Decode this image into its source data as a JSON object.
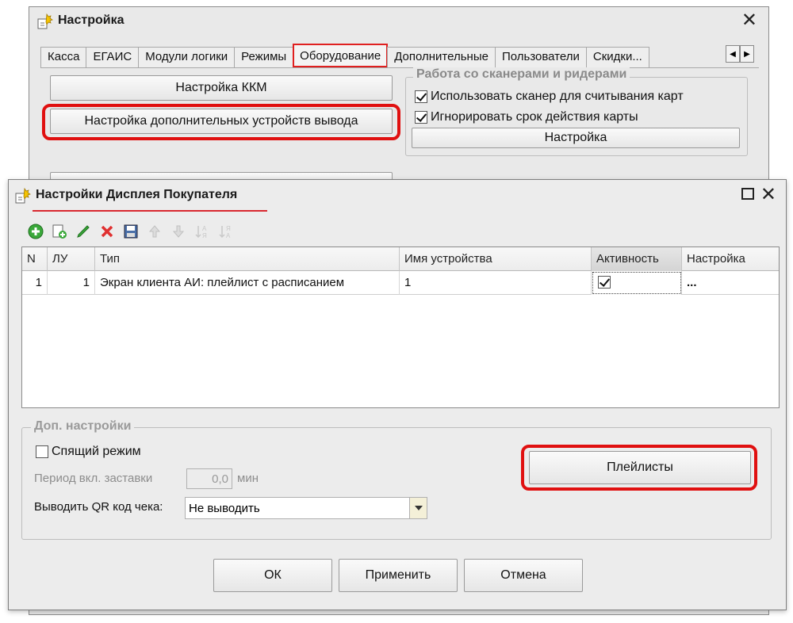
{
  "bg_window": {
    "title": "Настройка",
    "tabs": [
      "Касса",
      "ЕГАИС",
      "Модули логики",
      "Режимы",
      "Оборудование",
      "Дополнительные",
      "Пользователи",
      "Скидки..."
    ],
    "active_tab": "Оборудование",
    "kkm_button": "Настройка ККМ",
    "extra_devices_button": "Настройка дополнительных устройств вывода",
    "scanner_group": {
      "title": "Работа со сканерами и ридерами",
      "use_scanner": "Использовать сканер для считывания карт",
      "use_scanner_checked": true,
      "ignore_expiry": "Игнорировать срок действия карты",
      "ignore_expiry_checked": true,
      "settings_button": "Настройка"
    }
  },
  "dialog": {
    "title": "Настройки Дисплея Покупателя",
    "toolbar_icons": [
      "add-icon",
      "copy-icon",
      "edit-icon",
      "delete-icon",
      "save-icon",
      "move-up-icon",
      "move-down-icon",
      "sort-asc-icon",
      "sort-desc-icon"
    ],
    "table": {
      "columns": [
        "N",
        "ЛУ",
        "Тип",
        "Имя устройства",
        "Активность",
        "Настройка"
      ],
      "rows": [
        {
          "n": "1",
          "lu": "1",
          "type": "Экран клиента АИ: плейлист с расписанием",
          "device_name": "1",
          "active": true,
          "settings": "..."
        }
      ]
    },
    "extra": {
      "title": "Доп. настройки",
      "sleep_mode": "Спящий режим",
      "sleep_mode_checked": false,
      "screensaver_label": "Период вкл. заставки",
      "screensaver_value": "0,0",
      "screensaver_unit": "мин",
      "qr_label": "Выводить QR код чека:",
      "qr_value": "Не выводить",
      "playlists_button": "Плейлисты"
    },
    "buttons": {
      "ok": "ОК",
      "apply": "Применить",
      "cancel": "Отмена"
    }
  },
  "colors": {
    "highlight": "#e01010",
    "window_bg": "#ececec"
  }
}
